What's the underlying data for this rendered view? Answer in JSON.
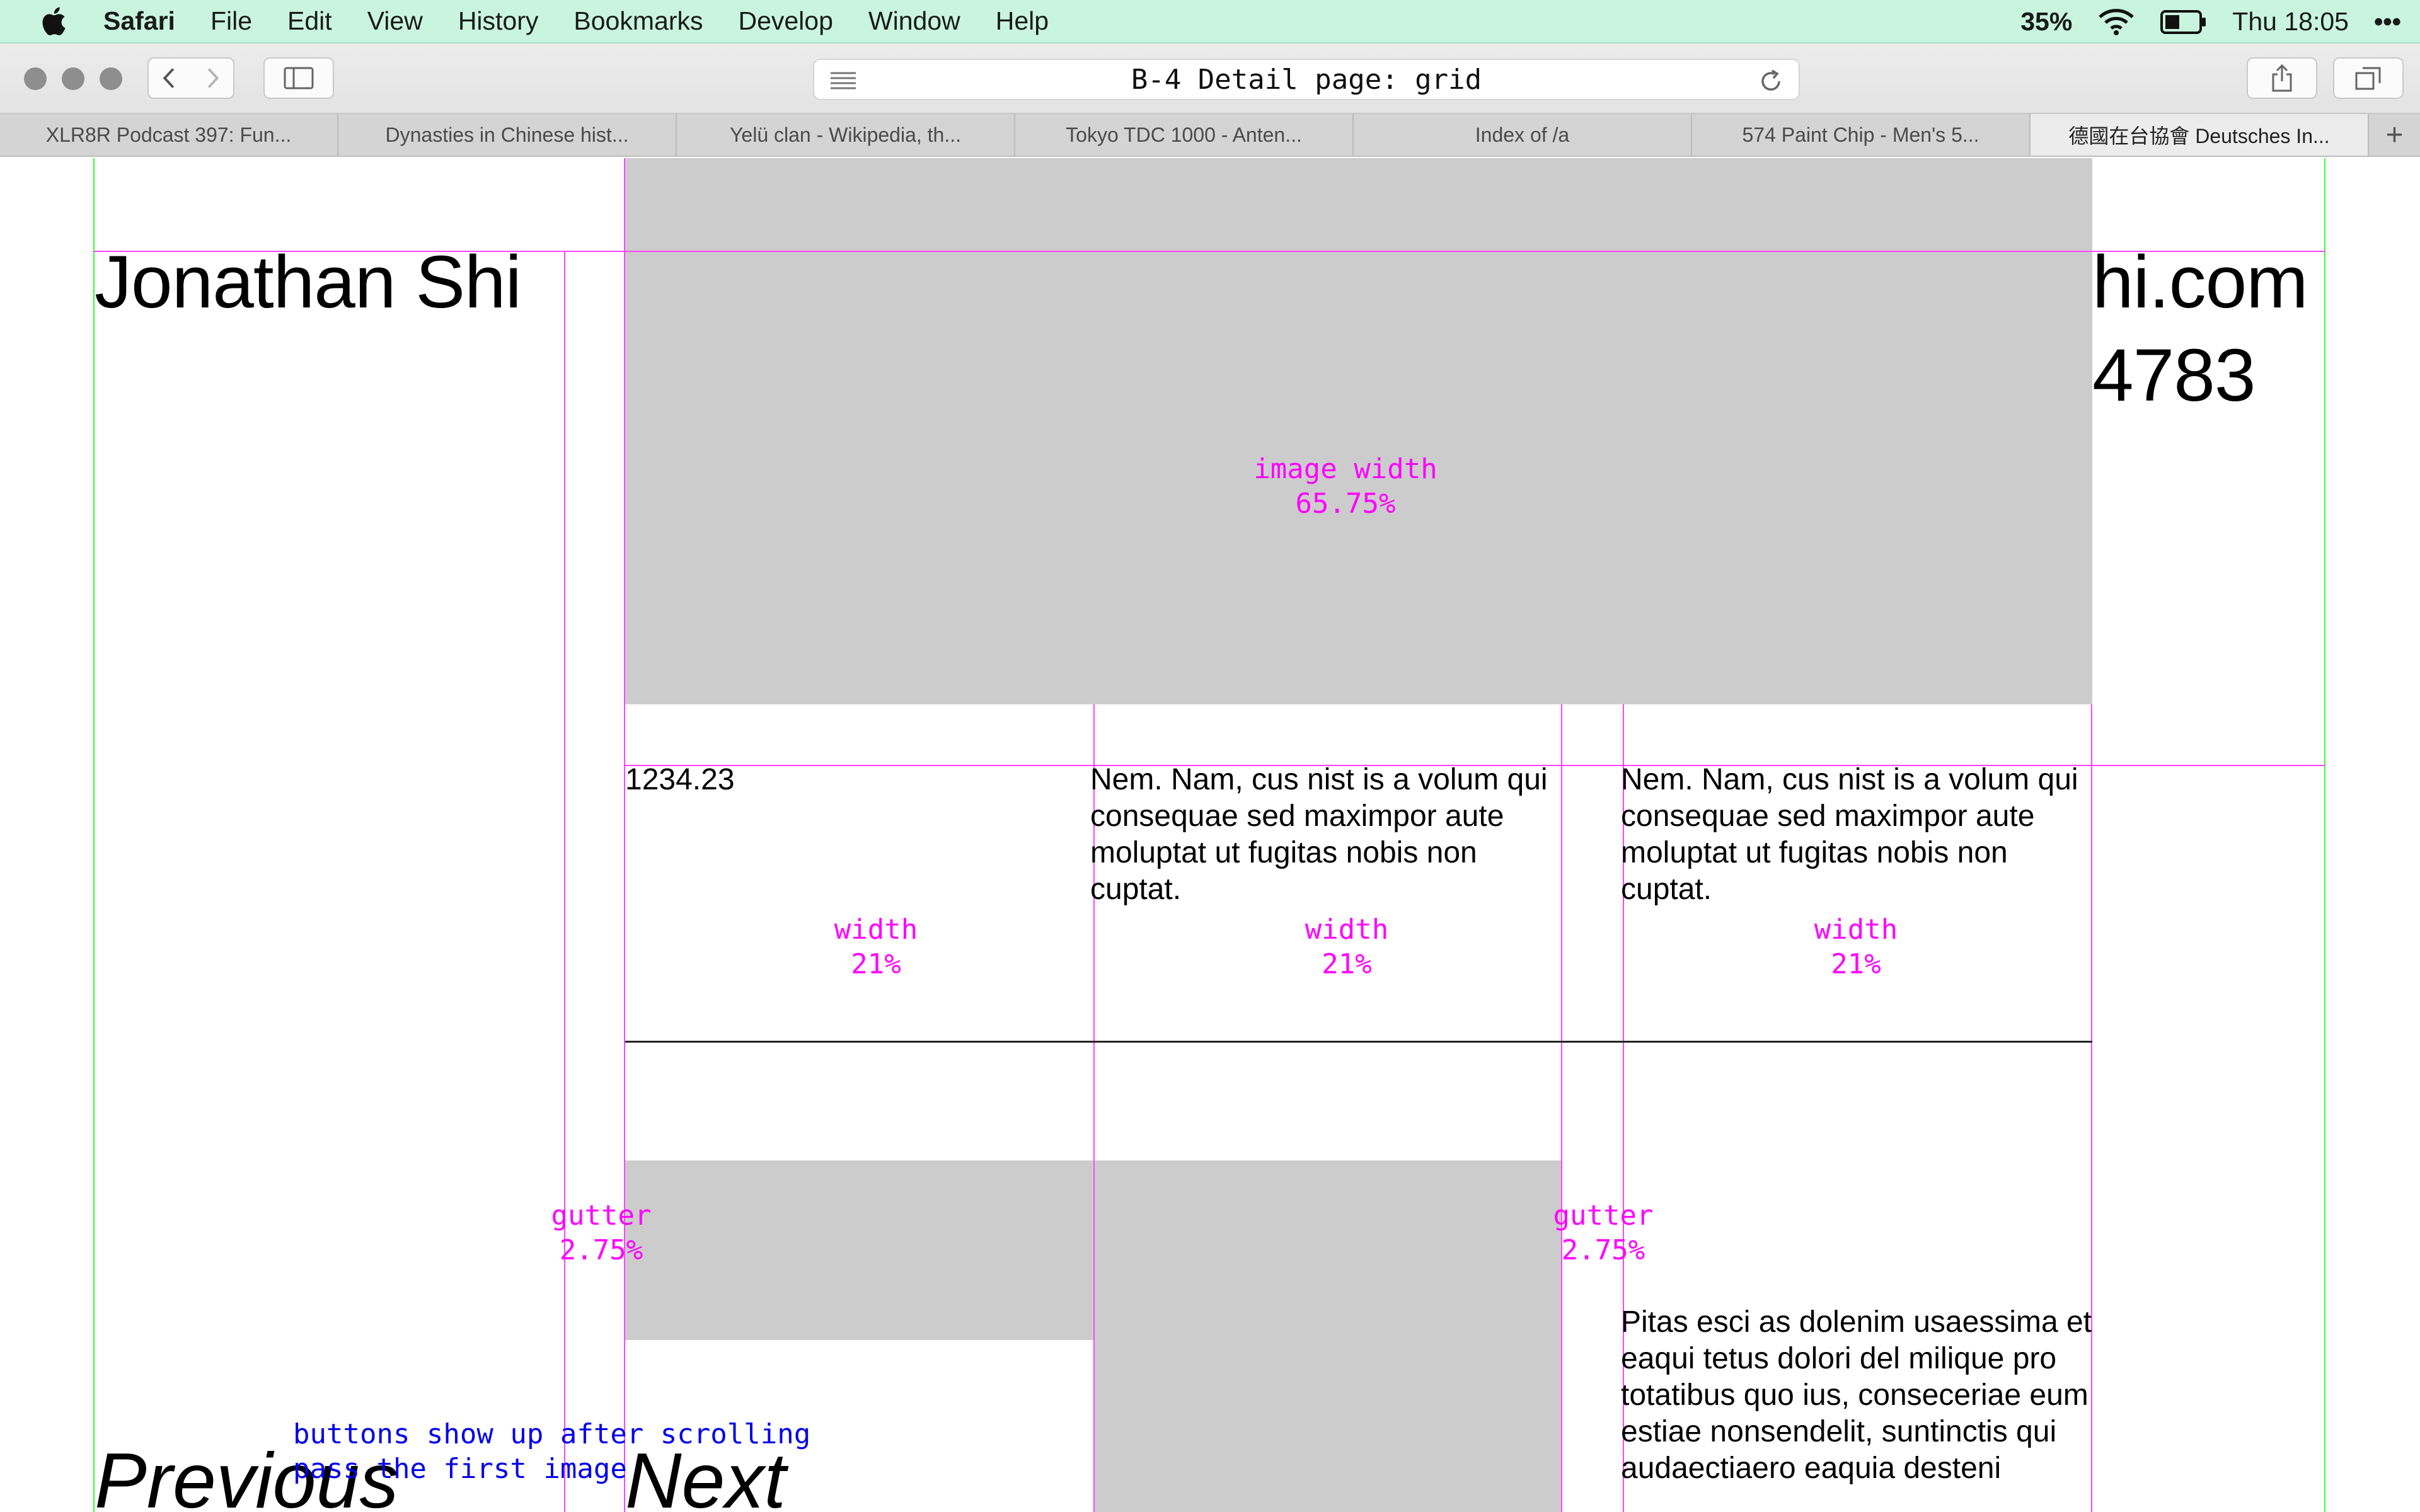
{
  "menubar": {
    "app_name": "Safari",
    "items": [
      "File",
      "Edit",
      "View",
      "History",
      "Bookmarks",
      "Develop",
      "Window",
      "Help"
    ],
    "battery_percent": "35%",
    "clock": "Thu 18:05",
    "more": "•••"
  },
  "toolbar": {
    "address_text": "B-4 Detail page: grid"
  },
  "tabs": [
    {
      "label": "XLR8R Podcast 397: Fun..."
    },
    {
      "label": "Dynasties in Chinese hist..."
    },
    {
      "label": "Yelü clan - Wikipedia, th..."
    },
    {
      "label": "Tokyo TDC 1000 - Anten..."
    },
    {
      "label": "Index of /a"
    },
    {
      "label": "574 Paint Chip - Men's 5..."
    },
    {
      "label": "德國在台協會 Deutsches In..."
    }
  ],
  "tab_add_label": "+",
  "page": {
    "name": "Jonathan Shi",
    "contact_line1": "hi.com",
    "contact_line2": "4783",
    "image_annotation_line1": "image width",
    "image_annotation_line2": "65.75%",
    "price": "1234.23",
    "column_text": "Nem. Nam, cus nist is a volum qui consequae sed maximpor aute moluptat ut fugitas nobis non cuptat.",
    "width_label": "width",
    "width_value": "21%",
    "gutter_label": "gutter",
    "gutter_value": "2.75%",
    "paragraph": "Pitas esci as dolenim usaessima et eaqui tetus dolori del milique pro totatibus quo ius, conseceriae eum estiae nonsendelit, suntinctis qui audaectiaero eaquia desteni",
    "previous_label": "Previous",
    "next_label": "Next",
    "note_line1": "buttons show up after scrolling",
    "note_line2": "pass the first image"
  },
  "colors": {
    "menubar_bg": "#c9f5e0",
    "grid_guide": "#ff44ff",
    "margin_guide": "#33ff33",
    "placeholder_gray": "#cccccc",
    "note_blue": "#0000ee"
  }
}
